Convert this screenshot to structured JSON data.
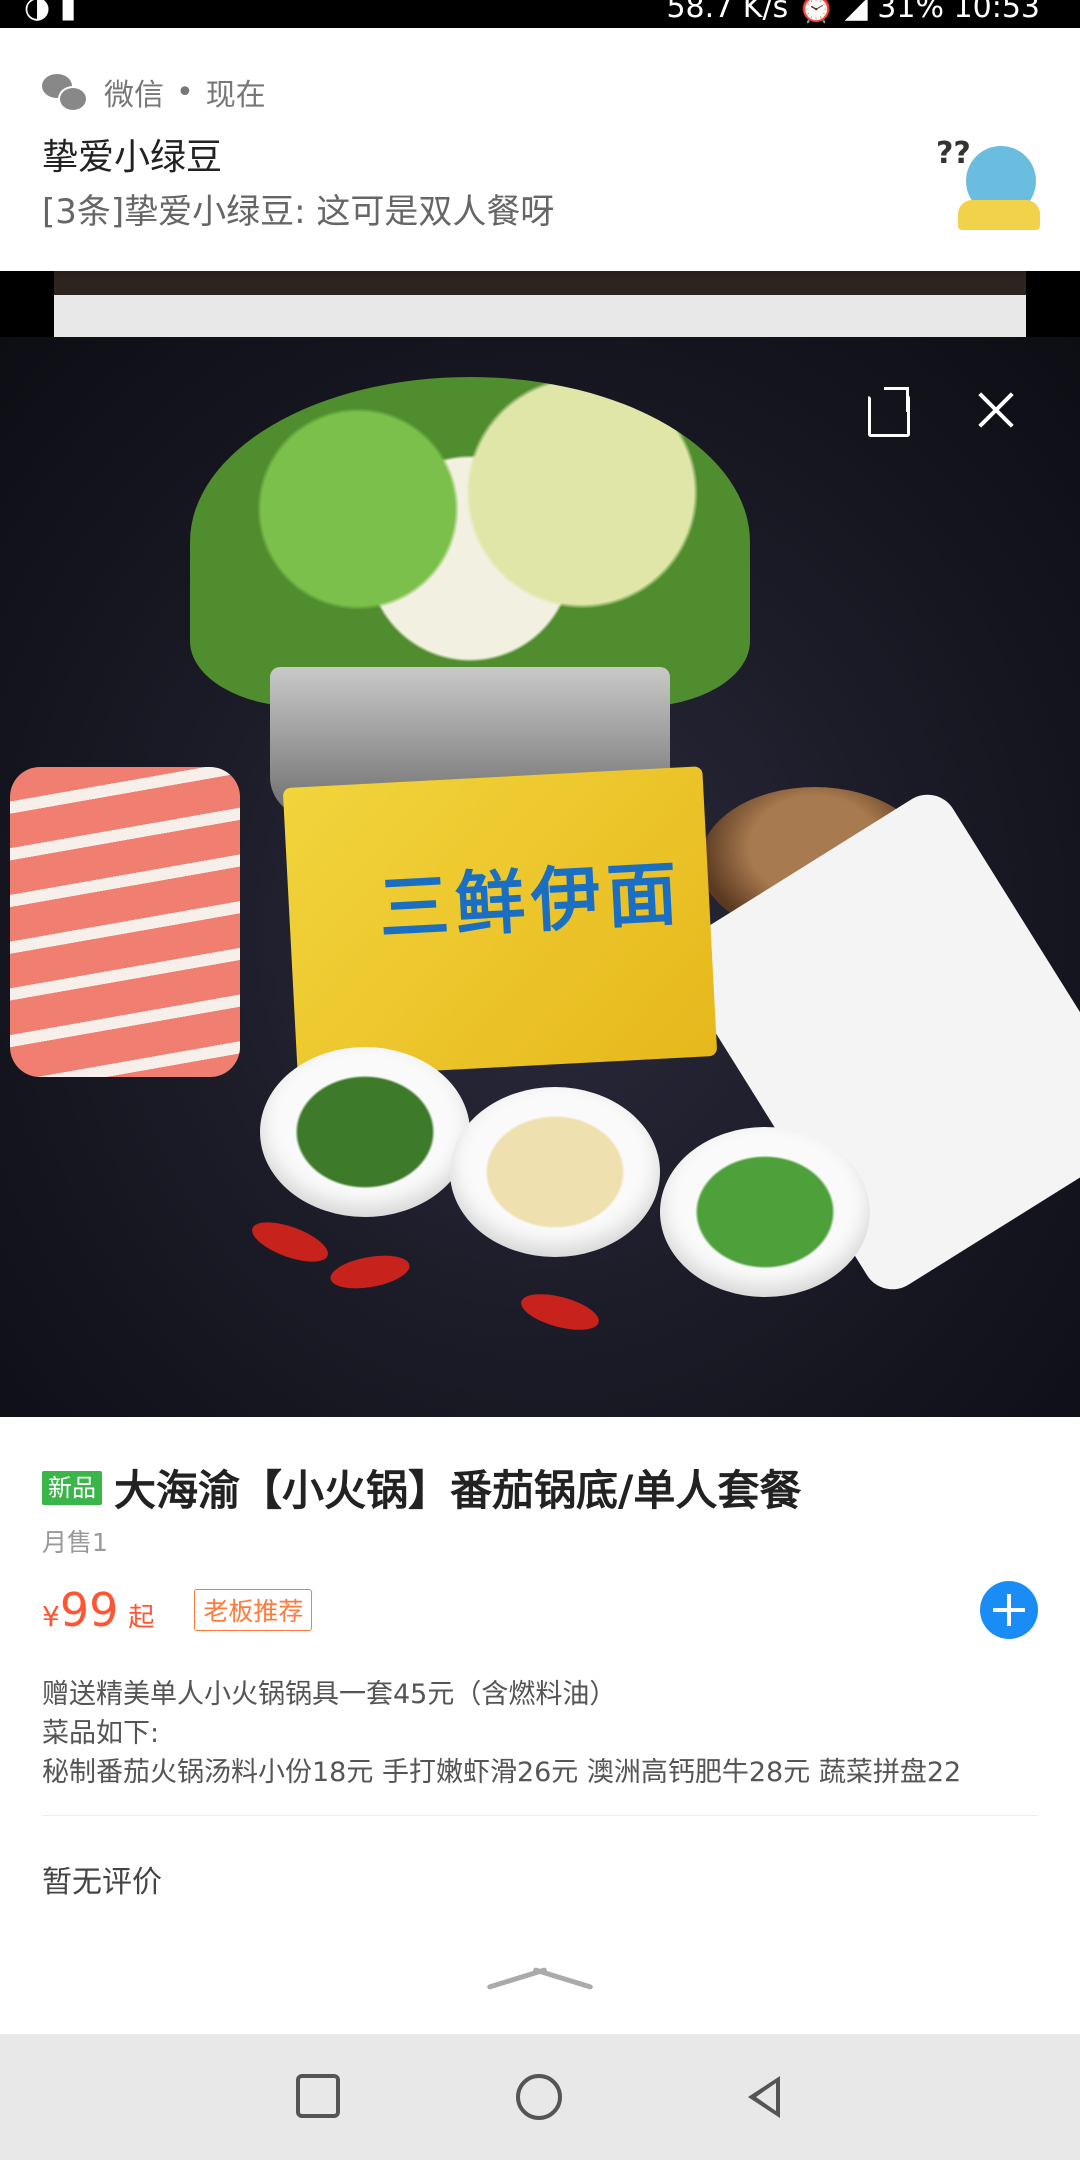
{
  "status_bar": {
    "network_speed": "58.7 K/s",
    "battery": "31%",
    "time": "10:53"
  },
  "notification": {
    "app_name": "微信",
    "separator": "•",
    "time": "现在",
    "sender": "挚爱小绿豆",
    "message": "[3条]挚爱小绿豆: 这可是双人餐呀"
  },
  "product": {
    "image_text": "三鲜伊面",
    "new_badge": "新品",
    "title": "大海渝【小火锅】番茄锅底/单人套餐",
    "monthly_sales": "月售1",
    "currency": "¥",
    "price": "99",
    "price_suffix": "起",
    "recommend_badge": "老板推荐",
    "description": [
      "赠送精美单人小火锅锅具一套45元（含燃料油）",
      "菜品如下:",
      "秘制番茄火锅汤料小份18元 手打嫩虾滑26元 澳洲高钙肥牛28元 蔬菜拼盘22"
    ],
    "reviews_text": "暂无评价"
  },
  "colors": {
    "price": "#ff5533",
    "new_badge": "#39b54a",
    "add_button": "#1a8cf5"
  }
}
